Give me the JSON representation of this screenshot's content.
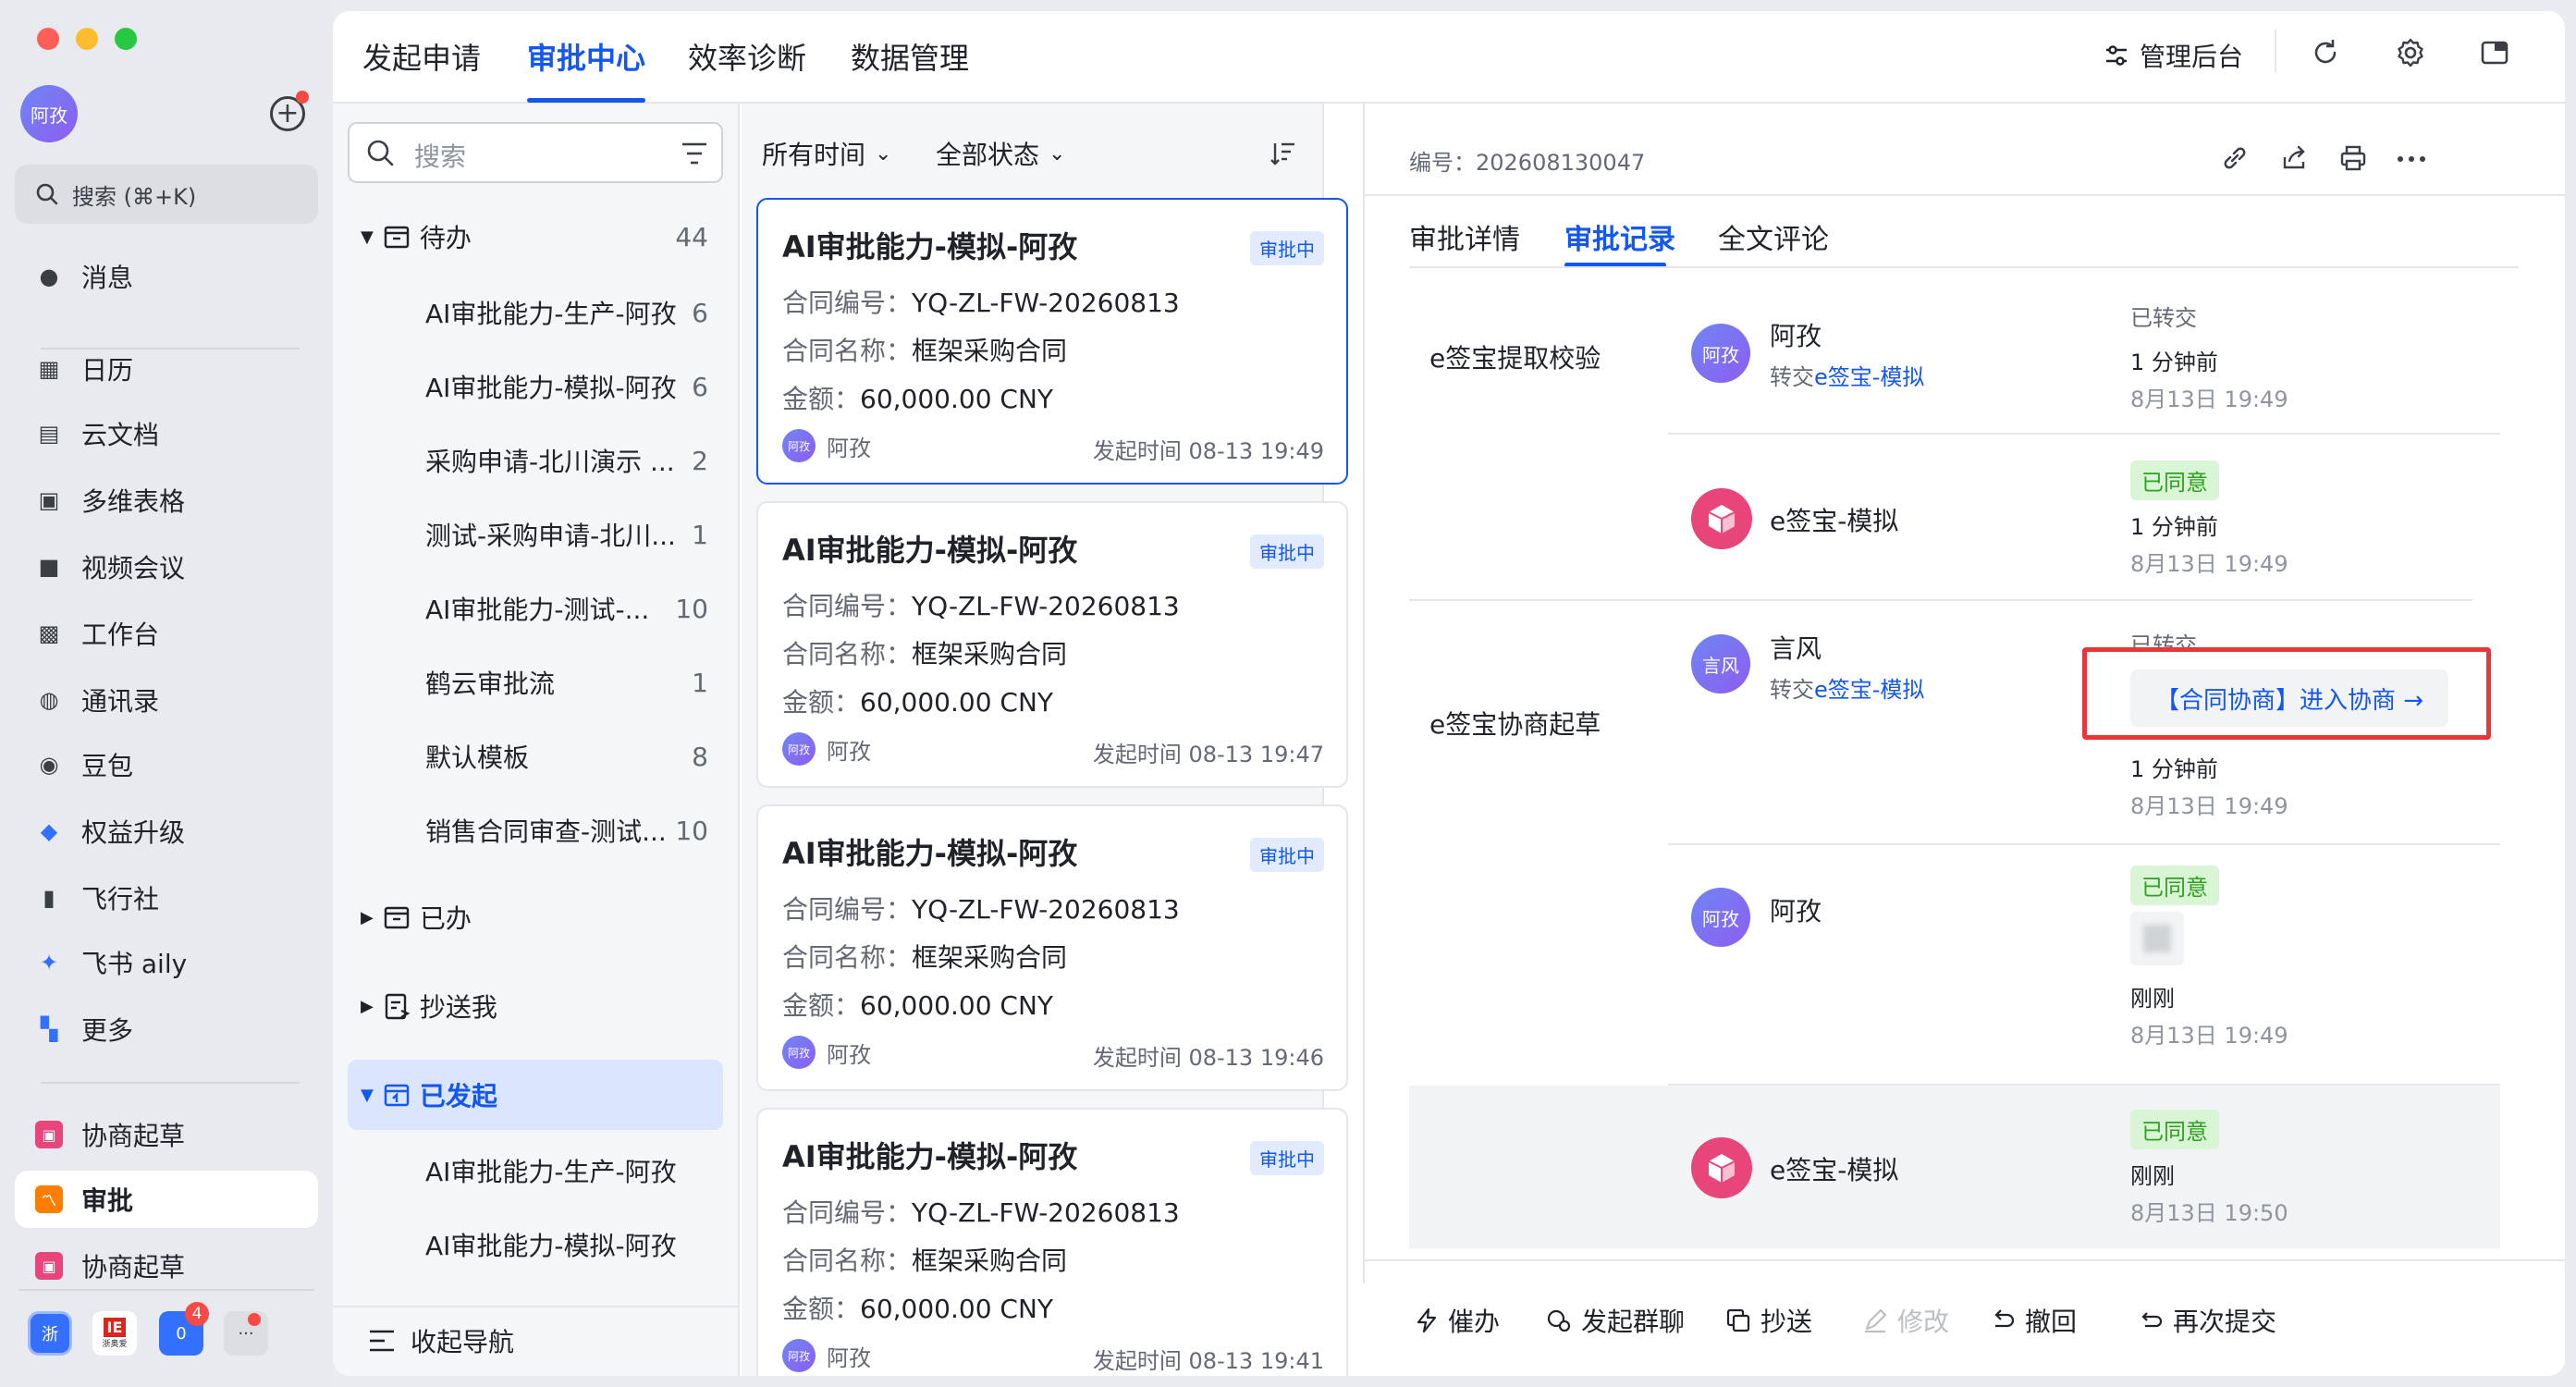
{
  "window": {
    "traffic_lights": [
      "#ff5f57",
      "#febc2e",
      "#28c840"
    ]
  },
  "sidebar": {
    "avatar_text": "阿孜",
    "search_label": "搜索 (⌘+K)",
    "items": [
      {
        "label": "消息",
        "icon": "chat-icon"
      },
      {
        "label": "日历",
        "icon": "calendar-icon"
      },
      {
        "label": "云文档",
        "icon": "docs-icon"
      },
      {
        "label": "多维表格",
        "icon": "base-icon"
      },
      {
        "label": "视频会议",
        "icon": "video-icon"
      },
      {
        "label": "工作台",
        "icon": "workplace-icon"
      },
      {
        "label": "通讯录",
        "icon": "contacts-icon"
      },
      {
        "label": "豆包",
        "icon": "doubao-icon"
      },
      {
        "label": "权益升级",
        "icon": "upgrade-icon"
      },
      {
        "label": "飞行社",
        "icon": "community-icon"
      },
      {
        "label": "飞书 aily",
        "icon": "aily-icon"
      },
      {
        "label": "更多",
        "icon": "more-apps-icon"
      }
    ],
    "pinned": [
      {
        "label": "协商起草",
        "icon": "draft-icon"
      },
      {
        "label": "审批",
        "icon": "approval-icon"
      },
      {
        "label": "协商起草",
        "icon": "draft-icon"
      }
    ],
    "dock": [
      {
        "label": "浙"
      },
      {
        "label": "IE",
        "sub": "浙奥爱"
      },
      {
        "label": "0",
        "badge": "4"
      },
      {
        "label": "···"
      }
    ]
  },
  "topnav": {
    "tabs": [
      "发起申请",
      "审批中心",
      "效率诊断",
      "数据管理"
    ],
    "active_tab": "审批中心",
    "admin_label": "管理后台"
  },
  "categories": {
    "search_placeholder": "搜索",
    "todo": {
      "label": "待办",
      "count": "44"
    },
    "todo_items": [
      {
        "label": "AI审批能力-生产-阿孜",
        "count": "6"
      },
      {
        "label": "AI审批能力-模拟-阿孜",
        "count": "6"
      },
      {
        "label": "采购申请-北川演示 ...",
        "count": "2"
      },
      {
        "label": "测试-采购申请-北川...",
        "count": "1"
      },
      {
        "label": "AI审批能力-测试-...",
        "count": "10"
      },
      {
        "label": "鹤云审批流",
        "count": "1"
      },
      {
        "label": "默认模板",
        "count": "8"
      },
      {
        "label": "销售合同审查-测试...",
        "count": "10"
      }
    ],
    "done": {
      "label": "已办"
    },
    "cc": {
      "label": "抄送我"
    },
    "initiated": {
      "label": "已发起"
    },
    "initiated_items": [
      {
        "label": "AI审批能力-生产-阿孜"
      },
      {
        "label": "AI审批能力-模拟-阿孜"
      }
    ],
    "collapse_label": "收起导航"
  },
  "list": {
    "filter_time": "所有时间",
    "filter_status": "全部状态",
    "cards": [
      {
        "title": "AI审批能力-模拟-阿孜",
        "badge": "审批中",
        "contract_no_k": "合同编号：",
        "contract_no": "YQ-ZL-FW-20260813",
        "contract_name_k": "合同名称：",
        "contract_name": "框架采购合同",
        "amount_k": "金额：",
        "amount": "60,000.00 CNY",
        "user": "阿孜",
        "time": "发起时间 08-13 19:49"
      },
      {
        "title": "AI审批能力-模拟-阿孜",
        "badge": "审批中",
        "contract_no_k": "合同编号：",
        "contract_no": "YQ-ZL-FW-20260813",
        "contract_name_k": "合同名称：",
        "contract_name": "框架采购合同",
        "amount_k": "金额：",
        "amount": "60,000.00 CNY",
        "user": "阿孜",
        "time": "发起时间 08-13 19:47"
      },
      {
        "title": "AI审批能力-模拟-阿孜",
        "badge": "审批中",
        "contract_no_k": "合同编号：",
        "contract_no": "YQ-ZL-FW-20260813",
        "contract_name_k": "合同名称：",
        "contract_name": "框架采购合同",
        "amount_k": "金额：",
        "amount": "60,000.00 CNY",
        "user": "阿孜",
        "time": "发起时间 08-13 19:46"
      },
      {
        "title": "AI审批能力-模拟-阿孜",
        "badge": "审批中",
        "contract_no_k": "合同编号：",
        "contract_no": "YQ-ZL-FW-20260813",
        "contract_name_k": "合同名称：",
        "contract_name": "框架采购合同",
        "amount_k": "金额：",
        "amount": "60,000.00 CNY",
        "user": "阿孜",
        "time": "发起时间 08-13 19:41"
      }
    ]
  },
  "detail": {
    "serial": "编号：202608130047",
    "tabs": [
      "审批详情",
      "审批记录",
      "全文评论"
    ],
    "active_tab": "审批记录",
    "nodes": [
      {
        "label": "e签宝提取校验"
      },
      {
        "label": "e签宝协商起草"
      }
    ],
    "records": [
      {
        "name": "阿孜",
        "sub_prefix": "转交",
        "sub_link": "e签宝-模拟",
        "status": "已转交",
        "ago": "1 分钟前",
        "date": "8月13日 19:49"
      },
      {
        "name": "e签宝-模拟",
        "status": "已同意",
        "ago": "1 分钟前",
        "date": "8月13日 19:49"
      },
      {
        "name": "言风",
        "sub_prefix": "转交",
        "sub_link": "e签宝-模拟",
        "status": "已转交",
        "link_button": "【合同协商】进入协商 →",
        "ago": "1 分钟前",
        "date": "8月13日 19:49"
      },
      {
        "name": "阿孜",
        "status": "已同意",
        "ago": "刚刚",
        "date": "8月13日 19:49"
      },
      {
        "name": "e签宝-模拟",
        "status": "已同意",
        "ago": "刚刚",
        "date": "8月13日 19:50"
      }
    ],
    "actions": [
      "催办",
      "发起群聊",
      "抄送",
      "修改",
      "撤回",
      "再次提交"
    ],
    "highlight_color": "#e8363a"
  }
}
